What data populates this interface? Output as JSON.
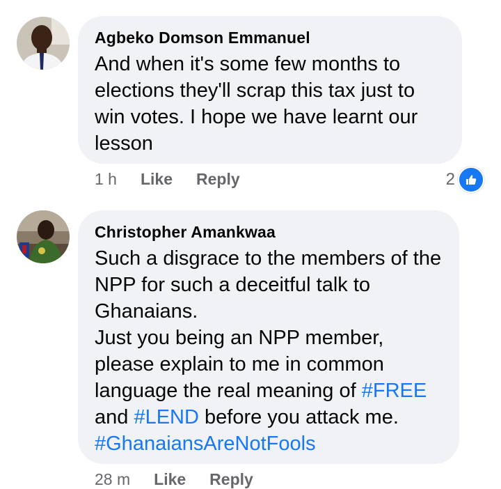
{
  "comments": [
    {
      "author": "Agbeko Domson Emmanuel",
      "text": "And when it's some few months to elections they'll scrap this tax just to win votes. I hope we have learnt our lesson",
      "time": "1 h",
      "like_label": "Like",
      "reply_label": "Reply",
      "reaction_count": "2",
      "reaction_icon": "like-icon"
    },
    {
      "author": "Christopher Amankwaa",
      "text_line1": "Such a disgrace to the members of the NPP for such a deceitful talk to Ghanaians.",
      "text_line2_a": "Just you being an NPP member, please explain to me in common language the real meaning of ",
      "hashtag_free": "#FREE",
      "text_line2_b": " and ",
      "hashtag_lend": "#LEND",
      "text_line2_c": " before you attack me.",
      "hashtag_fools": "#GhanaiansAreNotFools",
      "time": "28 m",
      "like_label": "Like",
      "reply_label": "Reply"
    }
  ],
  "colors": {
    "bubble": "#f0f2f5",
    "hashtag": "#1877f2",
    "meta": "#65676b",
    "like_badge": "#1877f2"
  }
}
